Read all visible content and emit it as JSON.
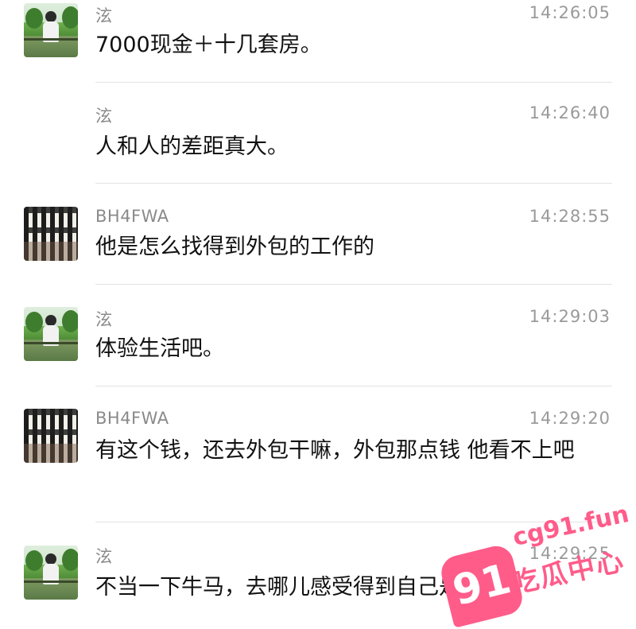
{
  "messages": [
    {
      "sender": "泫",
      "time": "14:26:05",
      "text": "7000现金＋十几套房。",
      "avatar": "anime-boy-avatar"
    },
    {
      "sender": "泫",
      "time": "14:26:40",
      "text": "人和人的差距真大。",
      "avatar": null
    },
    {
      "sender": "BH4FWA",
      "time": "14:28:55",
      "text": "他是怎么找得到外包的工作的",
      "avatar": "striped-avatar"
    },
    {
      "sender": "泫",
      "time": "14:29:03",
      "text": "体验生活吧。",
      "avatar": "anime-boy-avatar"
    },
    {
      "sender": "BH4FWA",
      "time": "14:29:20",
      "text": "有这个钱，还去外包干嘛，外包那点钱 他看不上吧",
      "avatar": "striped-avatar"
    },
    {
      "sender": "泫",
      "time": "14:29:25",
      "text": "不当一下牛马，去哪儿感受得到自己是富哥、",
      "avatar": "anime-boy-avatar"
    }
  ],
  "watermark": {
    "badge": "91",
    "url": "cg91.fun",
    "name": "吃瓜中心",
    "color": "#ff5c8a"
  }
}
